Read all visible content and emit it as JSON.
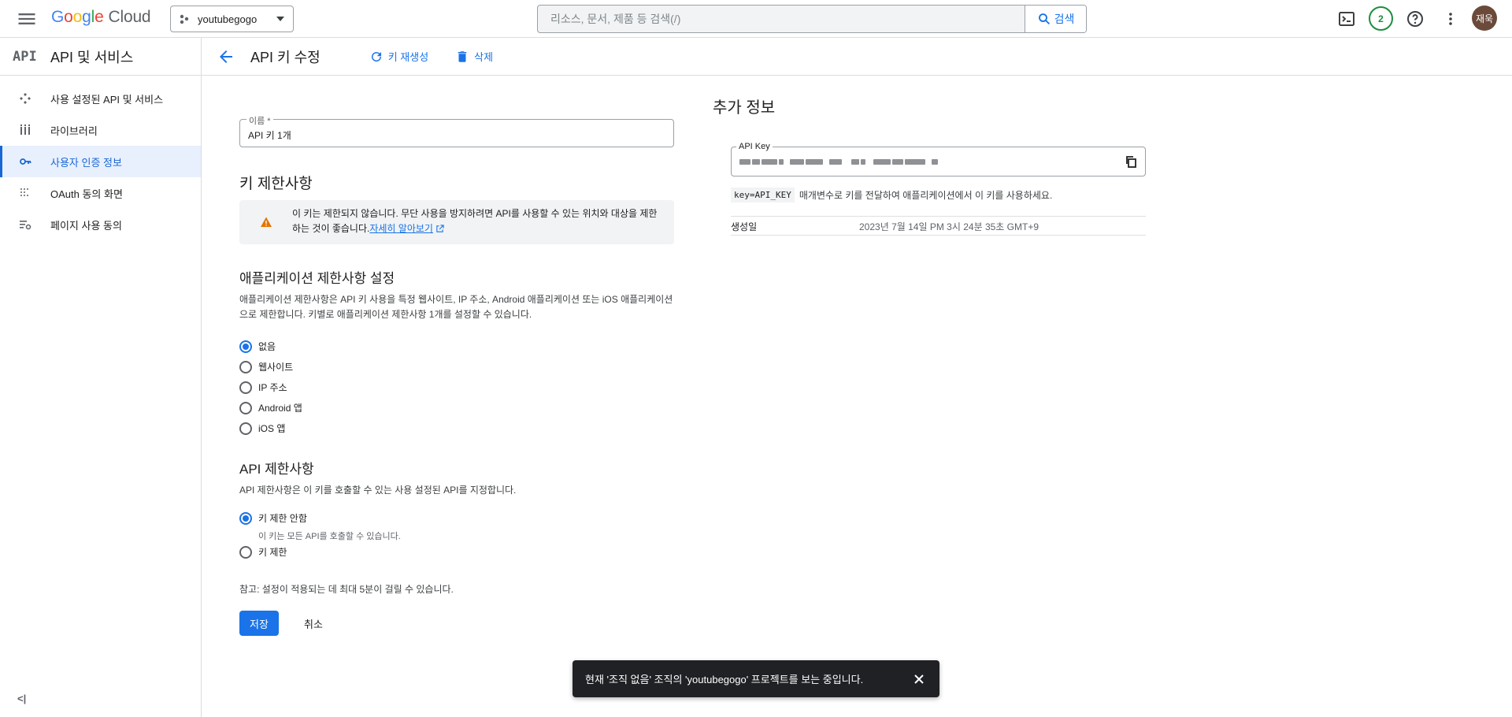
{
  "header": {
    "logo_google": [
      "G",
      "o",
      "o",
      "g",
      "l",
      "e"
    ],
    "logo_cloud": "Cloud",
    "project_name": "youtubegogo",
    "search_placeholder": "리소스, 문서, 제품 등 검색(/)",
    "search_button": "검색",
    "notification_count": "2",
    "avatar_initials": "재욱"
  },
  "sidebar": {
    "logo_text": "API",
    "title": "API 및 서비스",
    "items": [
      {
        "label": "사용 설정된 API 및 서비스",
        "icon": "enabled-apis-icon",
        "active": false
      },
      {
        "label": "라이브러리",
        "icon": "library-icon",
        "active": false
      },
      {
        "label": "사용자 인증 정보",
        "icon": "key-icon",
        "active": true
      },
      {
        "label": "OAuth 동의 화면",
        "icon": "oauth-icon",
        "active": false
      },
      {
        "label": "페이지 사용 동의",
        "icon": "page-usage-icon",
        "active": false
      }
    ],
    "collapse_label": "<|"
  },
  "subheader": {
    "title": "API 키 수정",
    "regenerate_label": "키 재생성",
    "delete_label": "삭제"
  },
  "form": {
    "name_label": "이름 *",
    "name_value": "API 키 1개",
    "restrictions_title": "키 제한사항",
    "warning_text": "이 키는 제한되지 않습니다. 무단 사용을 방지하려면 API를 사용할 수 있는 위치와 대상을 제한하는 것이 좋습니다.",
    "warning_link": "자세히 알아보기",
    "app_restriction_title": "애플리케이션 제한사항 설정",
    "app_restriction_desc": "애플리케이션 제한사항은 API 키 사용을 특정 웹사이트, IP 주소, Android 애플리케이션 또는 iOS 애플리케이션으로 제한합니다. 키별로 애플리케이션 제한사항 1개를 설정할 수 있습니다.",
    "app_options": [
      {
        "label": "없음",
        "selected": true
      },
      {
        "label": "웹사이트",
        "selected": false
      },
      {
        "label": "IP 주소",
        "selected": false
      },
      {
        "label": "Android 앱",
        "selected": false
      },
      {
        "label": "iOS 앱",
        "selected": false
      }
    ],
    "api_restriction_title": "API 제한사항",
    "api_restriction_desc": "API 제한사항은 이 키를 호출할 수 있는 사용 설정된 API를 지정합니다.",
    "api_options": [
      {
        "label": "키 제한 안함",
        "sub": "이 키는 모든 API를 호출할 수 있습니다.",
        "selected": true
      },
      {
        "label": "키 제한",
        "sub": "",
        "selected": false
      }
    ],
    "note": "참고: 설정이 적용되는 데 최대 5분이 걸릴 수 있습니다.",
    "save_label": "저장",
    "cancel_label": "취소"
  },
  "info": {
    "title": "추가 정보",
    "key_label": "API Key",
    "key_param": "key=API_KEY",
    "key_hint": "매개변수로 키를 전달하여 애플리케이션에서 이 키를 사용하세요.",
    "created_label": "생성일",
    "created_value": "2023년 7월 14일 PM 3시 24분 35초 GMT+9"
  },
  "snackbar": {
    "text": "현재 '조직 없음' 조직의 'youtubegogo' 프로젝트를 보는 중입니다."
  },
  "colors": {
    "accent": "#1a73e8",
    "active_bg": "#e8f0fe",
    "warning": "#e37400",
    "snackbar_bg": "#202124"
  }
}
